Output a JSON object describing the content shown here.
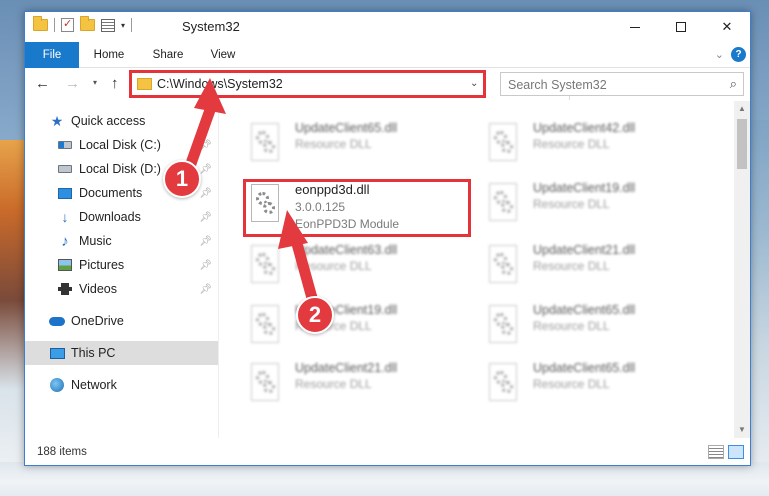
{
  "window": {
    "title": "System32"
  },
  "ribbon": {
    "file_label": "File",
    "home_label": "Home",
    "share_label": "Share",
    "view_label": "View",
    "help_label": "?"
  },
  "navbar": {
    "address_path": "C:\\Windows\\System32",
    "search_placeholder": "Search System32"
  },
  "sidebar": {
    "items": [
      {
        "label": "Quick access",
        "icon": "star-icon"
      },
      {
        "label": "Local Disk (C:)",
        "icon": "drive-icon",
        "pinned": true
      },
      {
        "label": "Local Disk (D:)",
        "icon": "drive-icon",
        "pinned": true
      },
      {
        "label": "Documents",
        "icon": "documents-icon",
        "pinned": true
      },
      {
        "label": "Downloads",
        "icon": "downloads-icon",
        "pinned": true
      },
      {
        "label": "Music",
        "icon": "music-icon",
        "pinned": true
      },
      {
        "label": "Pictures",
        "icon": "pictures-icon",
        "pinned": true
      },
      {
        "label": "Videos",
        "icon": "videos-icon",
        "pinned": true
      },
      {
        "label": "OneDrive",
        "icon": "onedrive-icon"
      },
      {
        "label": "This PC",
        "icon": "this-pc-icon",
        "selected": true
      },
      {
        "label": "Network",
        "icon": "network-icon"
      }
    ]
  },
  "files": {
    "focused": {
      "name": "eonppd3d.dll",
      "version": "3.0.0.125",
      "description": "EonPPD3D Module"
    },
    "left_column": [
      {
        "name": "UpdateClient65.dll",
        "description": "Resource DLL"
      },
      {
        "name": "UpdateClient63.dll",
        "description": "Resource DLL"
      },
      {
        "name": "UpdateClient19.dll",
        "description": "Resource DLL"
      },
      {
        "name": "UpdateClient21.dll",
        "description": "Resource DLL"
      }
    ],
    "right_column": [
      {
        "name": "UpdateClient42.dll",
        "description": "Resource DLL"
      },
      {
        "name": "UpdateClient19.dll",
        "description": "Resource DLL"
      },
      {
        "name": "UpdateClient21.dll",
        "description": "Resource DLL"
      },
      {
        "name": "UpdateClient65.dll",
        "description": "Resource DLL"
      },
      {
        "name": "UpdateClient65.dll",
        "description": "Resource DLL"
      }
    ]
  },
  "status": {
    "item_count": "188 items"
  },
  "annotations": {
    "step1": "1",
    "step2": "2",
    "color": "#e23a3f"
  }
}
